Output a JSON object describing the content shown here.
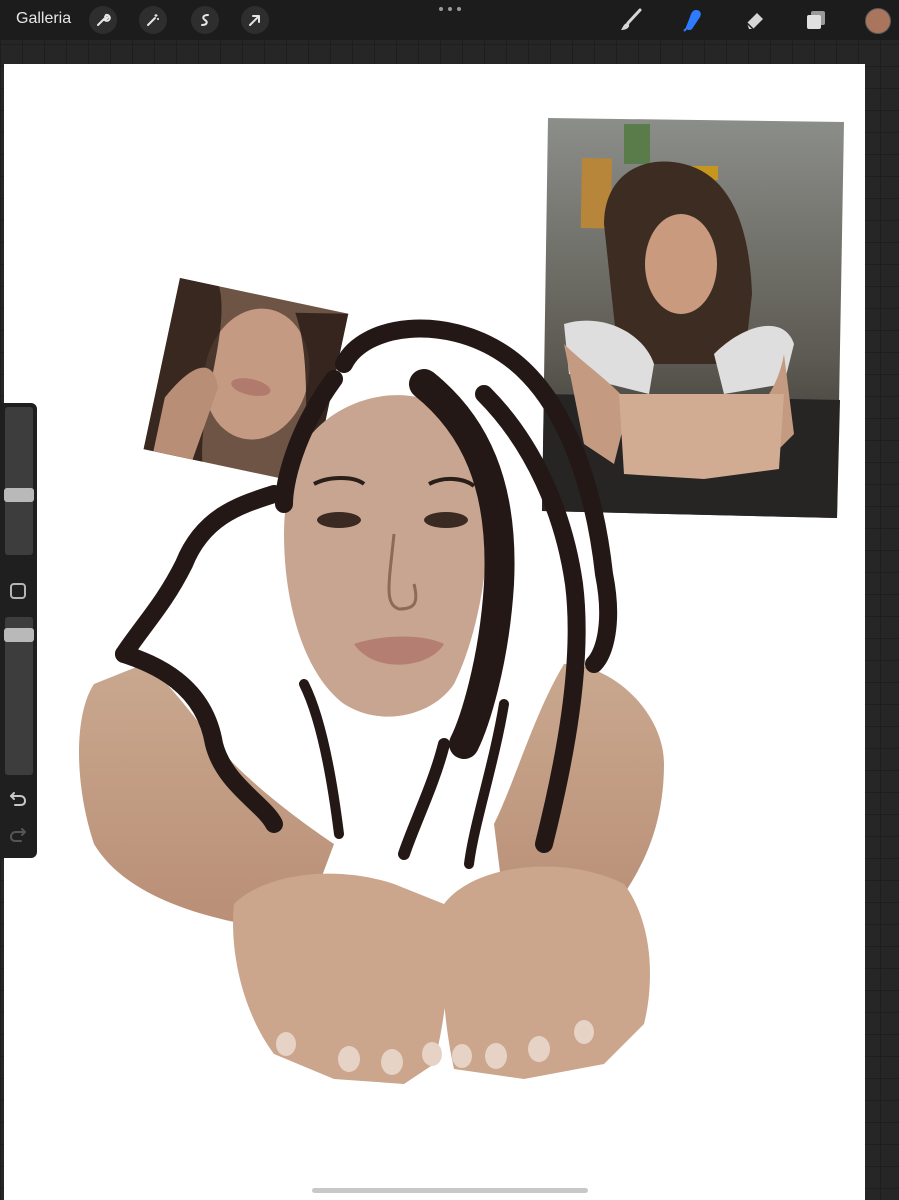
{
  "topbar": {
    "gallery_label": "Galleria",
    "left_tools": [
      "wrench-icon",
      "magic-wand-icon",
      "selection-icon",
      "transform-arrow-icon"
    ],
    "right_tools": [
      "brush-icon",
      "smudge-icon",
      "eraser-icon",
      "layers-icon"
    ],
    "active_tool": "smudge-icon",
    "active_color": "#a9765d",
    "accent_color": "#2f7bff"
  },
  "sidebar": {
    "size_slider_level": 0.6,
    "opacity_slider_level": 0.95,
    "icons": [
      "modify-square-icon",
      "undo-icon",
      "redo-icon"
    ]
  },
  "canvas": {
    "background": "#ffffff",
    "contents": [
      "reference-photo-selfie",
      "reference-photo-store-counter",
      "painting-face-hair-arms-hands"
    ]
  }
}
